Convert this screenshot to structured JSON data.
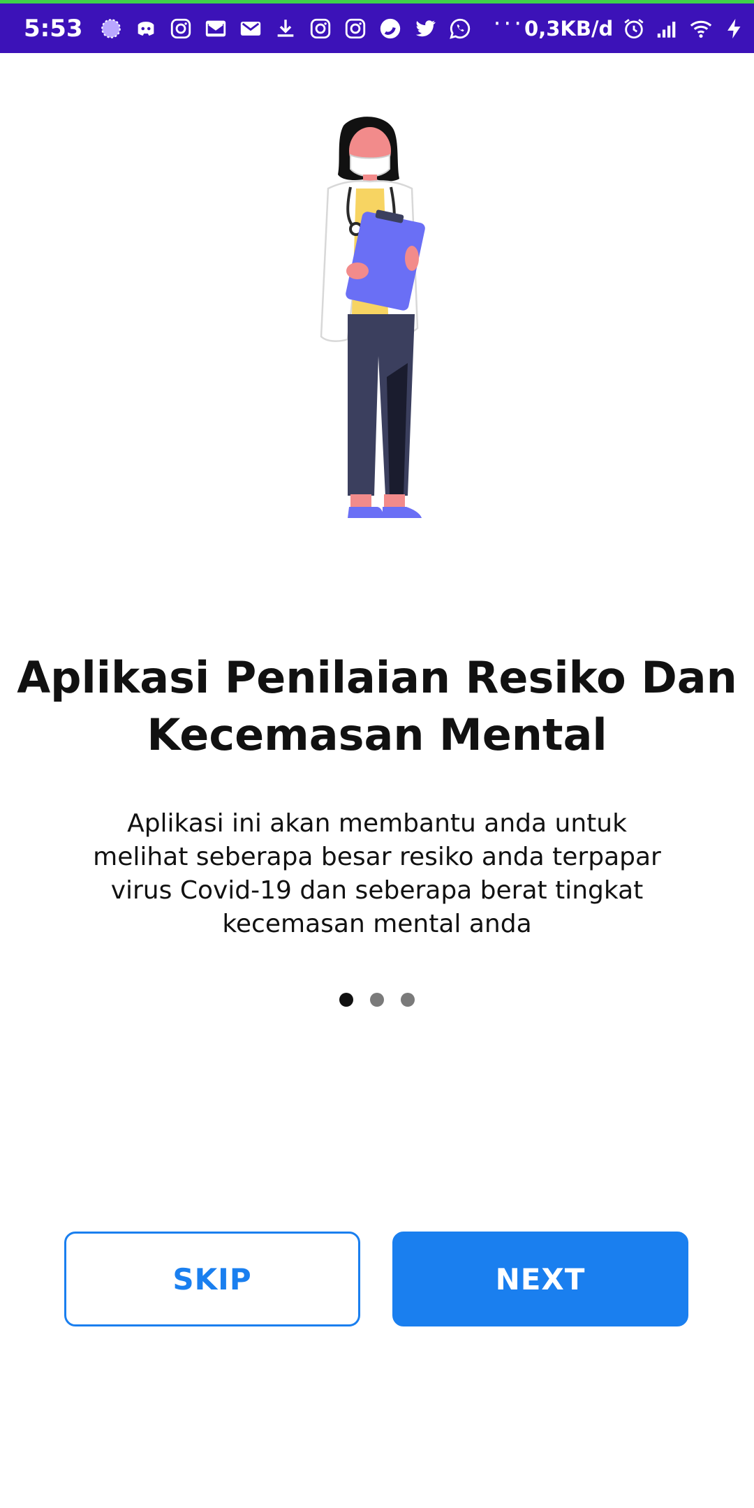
{
  "status_bar": {
    "time": "5:53",
    "network_speed": "0,3KB/d",
    "notification_icons": [
      "bubble-icon",
      "discord-icon",
      "instagram-icon",
      "gmail-icon",
      "gmail-icon",
      "download-icon",
      "instagram-icon",
      "instagram-icon",
      "opera-icon",
      "twitter-icon",
      "whatsapp-icon"
    ],
    "more": "···",
    "background": "#3c12b8"
  },
  "onboarding": {
    "illustration": "doctor-with-clipboard",
    "title": "Aplikasi Penilaian Resiko Dan Kecemasan Mental",
    "description": "Aplikasi ini akan membantu anda untuk melihat seberapa besar resiko anda terpapar virus Covid-19 dan seberapa berat tingkat kecemasan mental anda",
    "page_count": 3,
    "current_page": 1
  },
  "buttons": {
    "skip_label": "SKIP",
    "next_label": "NEXT",
    "accent": "#1a7fef"
  }
}
